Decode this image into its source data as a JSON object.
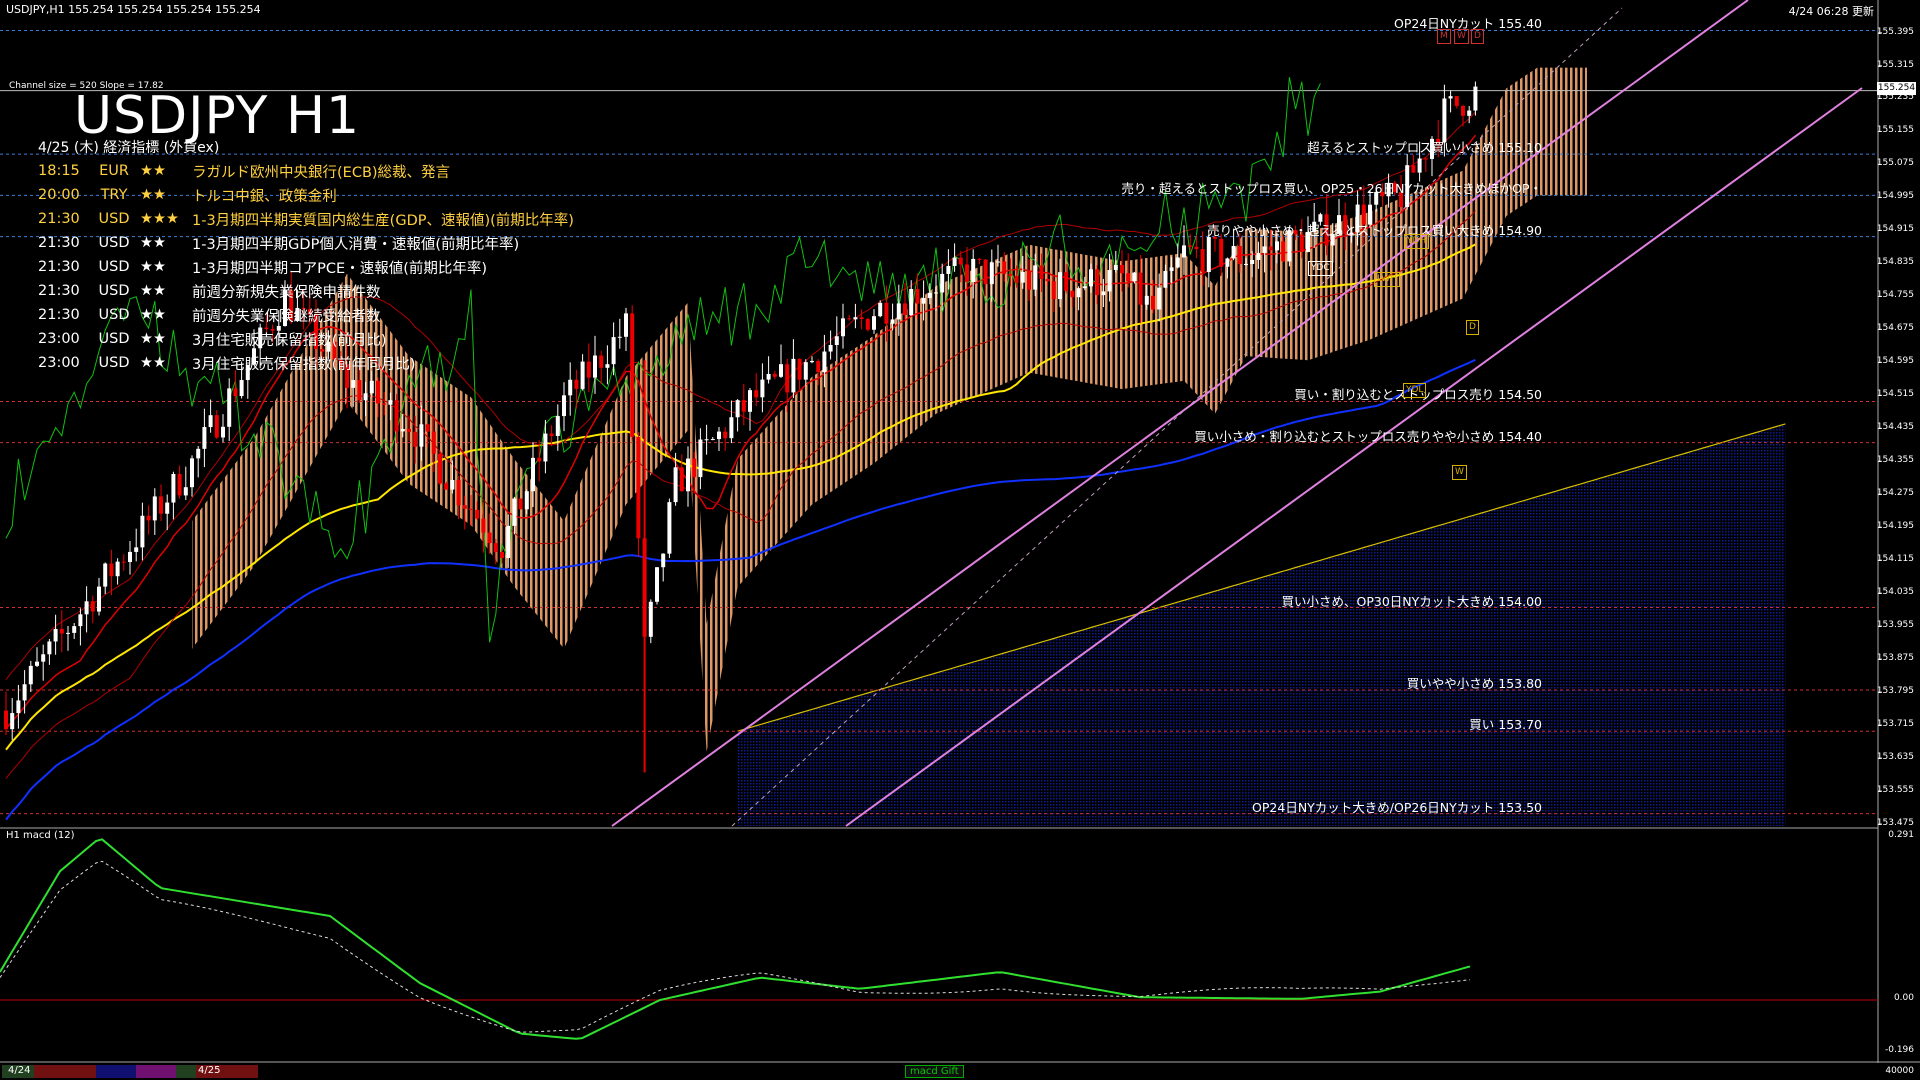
{
  "header": {
    "symbol_info": "USDJPY,H1  155.254 155.254 155.254 155.254",
    "datetime": "4/24 06:28 更新"
  },
  "overlay": {
    "channel_info": "Channel size = 520  Slope = 17.82",
    "symbol_title": "USDJPY H1",
    "events_title": "4/25 (木) 経済指標 (外貨ex)"
  },
  "events": [
    {
      "time": "18:15",
      "ccy": "EUR",
      "stars": "★★",
      "name": "ラガルド欧州中央銀行(ECB)総裁、発言",
      "color": "#ffd040"
    },
    {
      "time": "20:00",
      "ccy": "TRY",
      "stars": "★★",
      "name": "トルコ中銀、政策金利",
      "color": "#ffd040"
    },
    {
      "time": "21:30",
      "ccy": "USD",
      "stars": "★★★",
      "name": "1-3月期四半期実質国内総生産(GDP、速報値)(前期比年率)",
      "color": "#ffd040"
    },
    {
      "time": "21:30",
      "ccy": "USD",
      "stars": "★★",
      "name": "1-3月期四半期GDP個人消費・速報値(前期比年率)",
      "color": "#ffffff"
    },
    {
      "time": "21:30",
      "ccy": "USD",
      "stars": "★★",
      "name": "1-3月期四半期コアPCE・速報値(前期比年率)",
      "color": "#ffffff"
    },
    {
      "time": "21:30",
      "ccy": "USD",
      "stars": "★★",
      "name": "前週分新規失業保険申請件数",
      "color": "#ffffff"
    },
    {
      "time": "21:30",
      "ccy": "USD",
      "stars": "★★",
      "name": "前週分失業保険継続受給者数",
      "color": "#ffffff"
    },
    {
      "time": "23:00",
      "ccy": "USD",
      "stars": "★★",
      "name": "3月住宅販売保留指数(前月比)",
      "color": "#ffffff"
    },
    {
      "time": "23:00",
      "ccy": "USD",
      "stars": "★★",
      "name": "3月住宅販売保留指数(前年同月比)",
      "color": "#ffffff"
    }
  ],
  "levels": [
    {
      "label": "OP24日NYカット 155.40",
      "price": 155.4,
      "color": "#3a7dd8"
    },
    {
      "label": "超えるとストップロス買い小さめ 155.10",
      "price": 155.1,
      "color": "#3a7dd8"
    },
    {
      "label": "売り・超えるとストップロス買い、OP25・26日NYカット大きめほかOP・",
      "price": 155.0,
      "color": "#3a7dd8"
    },
    {
      "label": "売りやや小さめ・超えるとストップロス買い大きめ 154.90",
      "price": 154.9,
      "color": "#3a7dd8"
    },
    {
      "label": "買い・割り込むとストップロス売り 154.50",
      "price": 154.5,
      "color": "#d03030"
    },
    {
      "label": "買い小さめ・割り込むとストップロス売りやや小さめ 154.40",
      "price": 154.4,
      "color": "#d03030"
    },
    {
      "label": "買い小さめ、OP30日NYカット大きめ 154.00",
      "price": 154.0,
      "color": "#d03030"
    },
    {
      "label": "買いやや小さめ 153.80",
      "price": 153.8,
      "color": "#d03030"
    },
    {
      "label": "買い 153.70",
      "price": 153.7,
      "color": "#d03030"
    },
    {
      "label": "OP24日NYカット大きめ/OP26日NYカット 153.50",
      "price": 153.5,
      "color": "#d03030"
    }
  ],
  "price_axis": {
    "ticks": [
      "155.395",
      "155.315",
      "155.235",
      "155.155",
      "155.075",
      "154.995",
      "154.915",
      "154.835",
      "154.755",
      "154.675",
      "154.595",
      "154.515",
      "154.435",
      "154.355",
      "154.275",
      "154.195",
      "154.115",
      "154.035",
      "153.955",
      "153.875",
      "153.795",
      "153.715",
      "153.635",
      "153.555",
      "153.475"
    ],
    "current": "155.254",
    "top_price": 155.44,
    "bottom_price": 153.47
  },
  "macd": {
    "label": "H1  macd (12)",
    "axis_top": "0.291",
    "axis_zero": "0.00",
    "axis_bottom": "-0.196"
  },
  "timeline": {
    "dates": [
      "4/24",
      "4/25"
    ],
    "tag": "macd  Gift",
    "corner": "40000"
  },
  "badges": [
    {
      "text": "M",
      "color": "#d03030"
    },
    {
      "text": "W",
      "color": "#d03030"
    },
    {
      "text": "D",
      "color": "#d03030"
    },
    {
      "text": "YDH",
      "color": "#d8b000"
    },
    {
      "text": "LWH",
      "color": "#d8b000"
    },
    {
      "text": "YDC",
      "color": "#ffffff"
    },
    {
      "text": "D",
      "color": "#d8b000"
    },
    {
      "text": "YDL",
      "color": "#d8b000"
    },
    {
      "text": "W",
      "color": "#d8b000"
    }
  ]
}
